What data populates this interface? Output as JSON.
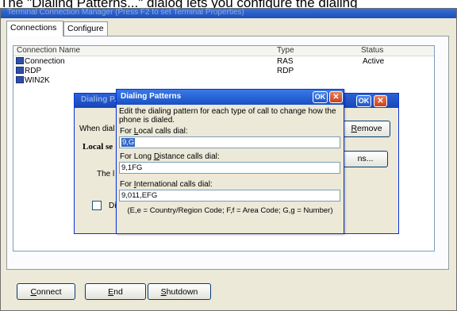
{
  "caption": {
    "prefix": "The \"",
    "underlined": "D",
    "suffix": "ialing Patterns...\" dialog lets you configure the dialing"
  },
  "main_window": {
    "title": "Terminal Connection Manager (Press F2 to set Terminal Properties)"
  },
  "tabs": [
    {
      "label": "Connections",
      "selected": true
    },
    {
      "label": "Configure",
      "selected": false
    }
  ],
  "list": {
    "columns": [
      "Connection Name",
      "Type",
      "Status"
    ],
    "rows": [
      {
        "name": "Connection",
        "type": "RAS",
        "status": "Active"
      },
      {
        "name": "RDP",
        "type": "RDP",
        "status": ""
      },
      {
        "name": "WIN2K",
        "type": "",
        "status": ""
      }
    ]
  },
  "bg_dialog": {
    "title": "Dialing P...",
    "when_dialing": "When dial",
    "remove_u": "R",
    "remove_rest": "emove",
    "local_settings": "Local se",
    "the_label": "The l",
    "dots_button": "ns...",
    "checkbox_label": "Di"
  },
  "fg_dialog": {
    "title": "Dialing Patterns",
    "ok": "OK",
    "description": "Edit the dialing pattern for each type of call to change how the phone is dialed.",
    "local": {
      "prefix": "For ",
      "u": "L",
      "suffix": "ocal calls dial:",
      "value": "9,G"
    },
    "long_distance": {
      "prefix": "For Long ",
      "u": "D",
      "suffix": "istance calls dial:",
      "value": "9,1FG"
    },
    "international": {
      "prefix": "For ",
      "u": "I",
      "suffix": "nternational calls dial:",
      "value": "9,011,EFG"
    },
    "legend": "(E,e = Country/Region Code; F,f = Area Code; G,g = Number)"
  },
  "bottom_buttons": [
    {
      "u": "C",
      "rest": "onnect"
    },
    {
      "u": "E",
      "rest": "nd"
    },
    {
      "u": "S",
      "rest": "hutdown"
    }
  ],
  "icons": {
    "connection": "computer-icon",
    "close": "close-icon"
  },
  "colors": {
    "titlebar": "#1a4fb9",
    "selection": "#316ac5",
    "close": "#c9411d"
  }
}
